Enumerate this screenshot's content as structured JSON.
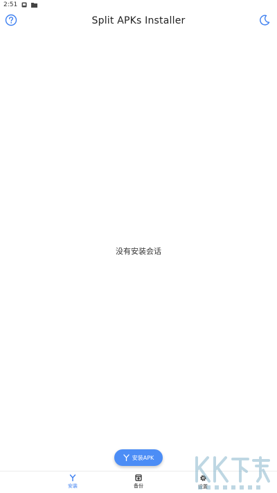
{
  "status_bar": {
    "time": "2:51",
    "icons": [
      "notification-icon",
      "folder-icon"
    ]
  },
  "app_bar": {
    "title": "Split APKs Installer",
    "left_icon": "help-icon",
    "right_icon": "moon-icon"
  },
  "main": {
    "empty_message": "没有安装会话"
  },
  "fab": {
    "label": "安装APK",
    "icon": "split-arrow-icon"
  },
  "bottom_nav": {
    "items": [
      {
        "label": "安装",
        "icon": "install-icon",
        "active": true
      },
      {
        "label": "备份",
        "icon": "backup-icon",
        "active": false
      },
      {
        "label": "设置",
        "icon": "gear-icon",
        "active": false
      }
    ]
  },
  "colors": {
    "accent": "#4c8df6",
    "nav_active": "#3b7ef0",
    "watermark": "#7fb0c8"
  }
}
